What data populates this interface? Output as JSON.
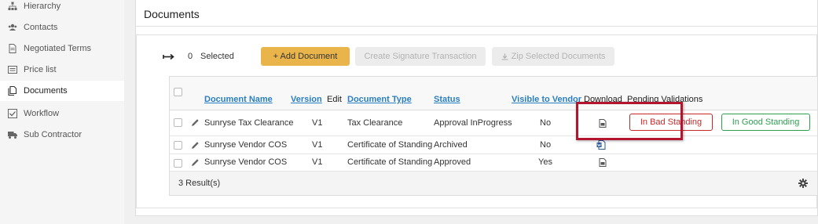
{
  "sidebar": {
    "items": [
      {
        "label": "Hierarchy",
        "icon": "hierarchy-icon"
      },
      {
        "label": "Contacts",
        "icon": "contacts-icon"
      },
      {
        "label": "Negotiated Terms",
        "icon": "document-icon"
      },
      {
        "label": "Price list",
        "icon": "list-icon"
      },
      {
        "label": "Documents",
        "icon": "documents-icon",
        "active": true
      },
      {
        "label": "Workflow",
        "icon": "checkbox-icon"
      },
      {
        "label": "Sub Contractor",
        "icon": "truck-icon"
      }
    ]
  },
  "panel": {
    "title": "Documents"
  },
  "toolbar": {
    "selected_count": "0",
    "selected_label": "Selected",
    "add_document": "+ Add Document",
    "create_signature": "Create Signature Transaction",
    "zip_selected": "Zip Selected Documents"
  },
  "table": {
    "headers": {
      "document_name": "Document Name",
      "version": "Version",
      "edit": "Edit",
      "document_type": "Document Type",
      "status": "Status",
      "visible_to_vendor": "Visible to Vendor",
      "download": "Download",
      "pending_validations": "Pending Validations"
    },
    "rows": [
      {
        "name": "Sunryse Tax Clearance",
        "version": "V1",
        "type": "Tax Clearance",
        "status": "Approval InProgress",
        "visible": "No",
        "download_icon": "file-icon"
      },
      {
        "name": "Sunryse Vendor COS",
        "version": "V1",
        "type": "Certificate of Standing",
        "status": "Archived",
        "visible": "No",
        "download_icon": "word-file-icon"
      },
      {
        "name": "Sunryse Vendor COS",
        "version": "V1",
        "type": "Certificate of Standing",
        "status": "Approved",
        "visible": "Yes",
        "download_icon": "file-icon"
      }
    ],
    "validation_buttons": {
      "bad": "In Bad Standing",
      "good": "In Good Standing"
    },
    "results": "3 Result(s)"
  },
  "colors": {
    "accent": "#e9b54b",
    "link": "#2a7fc0",
    "bad": "#c62828",
    "good": "#2e9e4e",
    "highlight": "#b3152f"
  }
}
